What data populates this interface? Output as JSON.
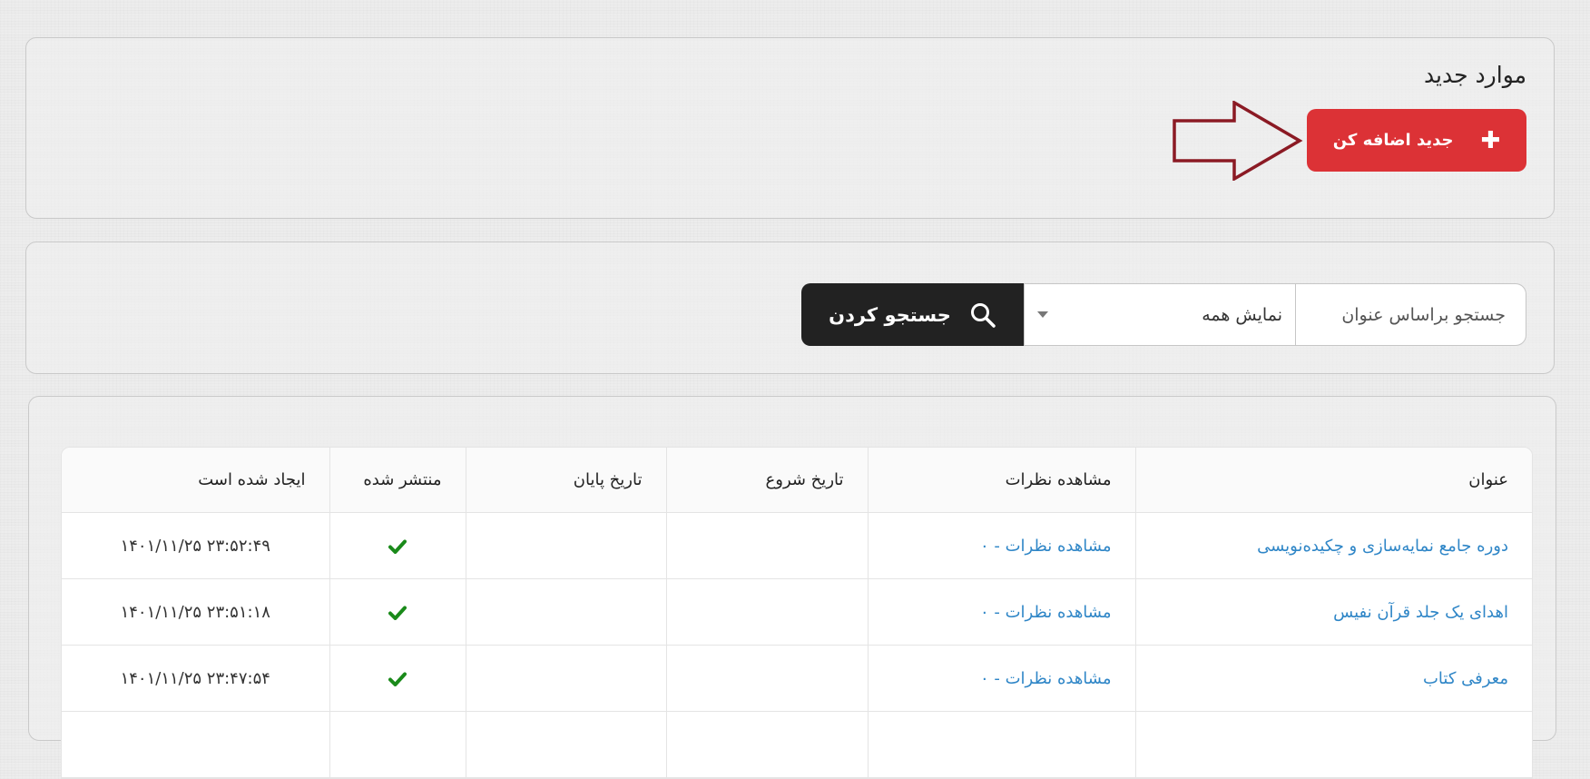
{
  "new_items": {
    "title": "موارد جدید",
    "add_button_label": "جدید اضافه کن",
    "add_button_color": "#dc3236",
    "annotation_arrow_color": "#8b1a24"
  },
  "search": {
    "placeholder": "جستجو براساس عنوان",
    "filter_selected": "نمایش همه",
    "button_label": "جستجو کردن"
  },
  "table": {
    "headers": {
      "title": "عنوان",
      "comments": "مشاهده نظرات",
      "start_date": "تاریخ شروع",
      "end_date": "تاریخ پایان",
      "published": "منتشر شده",
      "created": "ایجاد شده است"
    },
    "rows": [
      {
        "title": "دوره جامع نمایه‌سازی و چکیده‌نویسی",
        "comments": "مشاهده نظرات - ۰",
        "start_date": "",
        "end_date": "",
        "published": true,
        "created": "۱۴۰۱/۱۱/۲۵ ۲۳:۵۲:۴۹"
      },
      {
        "title": "اهدای یک جلد قرآن نفیس",
        "comments": "مشاهده نظرات - ۰",
        "start_date": "",
        "end_date": "",
        "published": true,
        "created": "۱۴۰۱/۱۱/۲۵ ۲۳:۵۱:۱۸"
      },
      {
        "title": "معرفی کتاب",
        "comments": "مشاهده نظرات - ۰",
        "start_date": "",
        "end_date": "",
        "published": true,
        "created": "۱۴۰۱/۱۱/۲۵ ۲۳:۴۷:۵۴"
      }
    ],
    "link_color": "#2f86c7",
    "check_color": "#1a8a1a"
  }
}
